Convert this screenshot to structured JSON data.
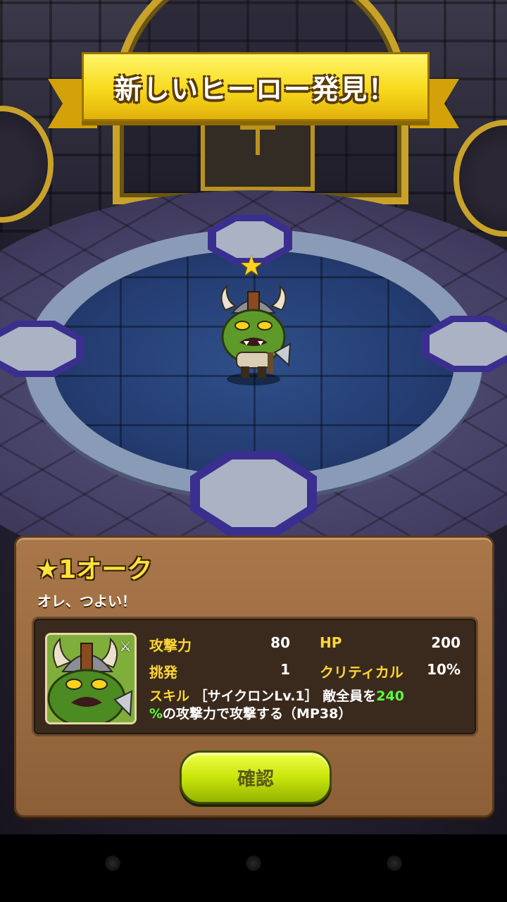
{
  "banner": {
    "title": "新しいヒーロー発見！"
  },
  "hero": {
    "name": "★1オーク",
    "quote": "オレ、つよい！",
    "rarity_stars": 1
  },
  "stats": {
    "attack_label": "攻撃力",
    "attack_value": "80",
    "hp_label": "HP",
    "hp_value": "200",
    "provoke_label": "挑発",
    "provoke_value": "1",
    "crit_label": "クリティカル",
    "crit_value": "10%"
  },
  "skill": {
    "label": "スキル",
    "name": "［サイクロンLv.1］",
    "desc_pre": "敵全員を",
    "desc_num": "240",
    "desc_pct": "%",
    "desc_post": "の攻撃力で攻撃する（MP38）"
  },
  "button": {
    "confirm_label": "確認"
  },
  "icons": {
    "star": "star-icon",
    "hero_sprite": "orc-hero-sprite",
    "portrait": "orc-portrait-icon",
    "crossed_swords": "crossed-swords-icon"
  },
  "colors": {
    "title_yellow": "#ffe33a",
    "stat_label": "#ffd733",
    "highlight_green": "#5cff3a",
    "button_green": "#c9e50a"
  }
}
